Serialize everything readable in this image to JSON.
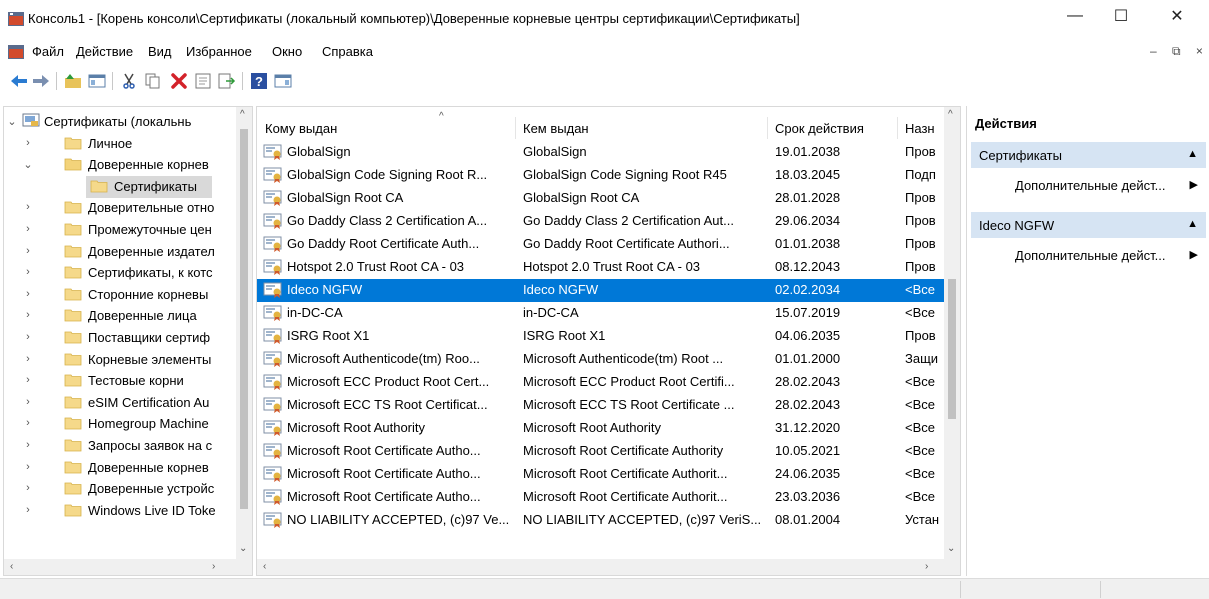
{
  "window": {
    "title": "Консоль1 - [Корень консоли\\Сертификаты (локальный компьютер)\\Доверенные корневые центры сертификации\\Сертификаты]",
    "min": "—",
    "max": "☐",
    "close": "✕"
  },
  "menu": [
    "Файл",
    "Действие",
    "Вид",
    "Избранное",
    "Окно",
    "Справка"
  ],
  "mdi": "– ⧉ ×",
  "tree": {
    "root": "Сертификаты (локальнь",
    "items": [
      {
        "label": "Личное",
        "exp": "›"
      },
      {
        "label": "Доверенные корнев",
        "exp": "⌄"
      },
      {
        "label": "Сертификаты",
        "exp": ""
      },
      {
        "label": "Доверительные отно",
        "exp": "›"
      },
      {
        "label": "Промежуточные цен",
        "exp": "›"
      },
      {
        "label": "Доверенные издател",
        "exp": "›"
      },
      {
        "label": "Сертификаты, к котс",
        "exp": "›"
      },
      {
        "label": "Сторонние корневы",
        "exp": "›"
      },
      {
        "label": "Доверенные лица",
        "exp": "›"
      },
      {
        "label": "Поставщики сертиф",
        "exp": "›"
      },
      {
        "label": "Корневые элементы",
        "exp": "›"
      },
      {
        "label": "Тестовые корни",
        "exp": "›"
      },
      {
        "label": "eSIM Certification Au",
        "exp": "›"
      },
      {
        "label": "Homegroup Machine",
        "exp": "›"
      },
      {
        "label": "Запросы заявок на с",
        "exp": "›"
      },
      {
        "label": "Доверенные корнев",
        "exp": "›"
      },
      {
        "label": "Доверенные устройс",
        "exp": "›"
      },
      {
        "label": "Windows Live ID Toke",
        "exp": "›"
      }
    ]
  },
  "list": {
    "columns": [
      "Кому выдан",
      "Кем выдан",
      "Срок действия",
      "Назн"
    ],
    "rows": [
      [
        "GlobalSign",
        "GlobalSign",
        "19.01.2038",
        "Пров"
      ],
      [
        "GlobalSign Code Signing Root R...",
        "GlobalSign Code Signing Root R45",
        "18.03.2045",
        "Подп"
      ],
      [
        "GlobalSign Root CA",
        "GlobalSign Root CA",
        "28.01.2028",
        "Пров"
      ],
      [
        "Go Daddy Class 2 Certification A...",
        "Go Daddy Class 2 Certification Aut...",
        "29.06.2034",
        "Пров"
      ],
      [
        "Go Daddy Root Certificate Auth...",
        "Go Daddy Root Certificate Authori...",
        "01.01.2038",
        "Пров"
      ],
      [
        "Hotspot 2.0 Trust Root CA - 03",
        "Hotspot 2.0 Trust Root CA - 03",
        "08.12.2043",
        "Пров"
      ],
      [
        "Ideco NGFW",
        "Ideco NGFW",
        "02.02.2034",
        "<Все"
      ],
      [
        "in-DC-CA",
        "in-DC-CA",
        "15.07.2019",
        "<Все"
      ],
      [
        "ISRG Root X1",
        "ISRG Root X1",
        "04.06.2035",
        "Пров"
      ],
      [
        "Microsoft Authenticode(tm) Roo...",
        "Microsoft Authenticode(tm) Root ...",
        "01.01.2000",
        "Защи"
      ],
      [
        "Microsoft ECC Product Root Cert...",
        "Microsoft ECC Product Root Certifi...",
        "28.02.2043",
        "<Все"
      ],
      [
        "Microsoft ECC TS Root Certificat...",
        "Microsoft ECC TS Root Certificate ...",
        "28.02.2043",
        "<Все"
      ],
      [
        "Microsoft Root Authority",
        "Microsoft Root Authority",
        "31.12.2020",
        "<Все"
      ],
      [
        "Microsoft Root Certificate Autho...",
        "Microsoft Root Certificate Authority",
        "10.05.2021",
        "<Все"
      ],
      [
        "Microsoft Root Certificate Autho...",
        "Microsoft Root Certificate Authorit...",
        "24.06.2035",
        "<Все"
      ],
      [
        "Microsoft Root Certificate Autho...",
        "Microsoft Root Certificate Authorit...",
        "23.03.2036",
        "<Все"
      ],
      [
        "NO LIABILITY ACCEPTED, (c)97 Ve...",
        "NO LIABILITY ACCEPTED, (c)97 VeriS...",
        "08.01.2004",
        "Устан"
      ]
    ],
    "selected_index": 6
  },
  "actions": {
    "title": "Действия",
    "sections": [
      {
        "label": "Сертификаты",
        "item": "Дополнительные дейст..."
      },
      {
        "label": "Ideco NGFW",
        "item": "Дополнительные дейст..."
      }
    ]
  },
  "colors": {
    "selection": "#0078d7",
    "section_bg": "#d6e4f3"
  }
}
